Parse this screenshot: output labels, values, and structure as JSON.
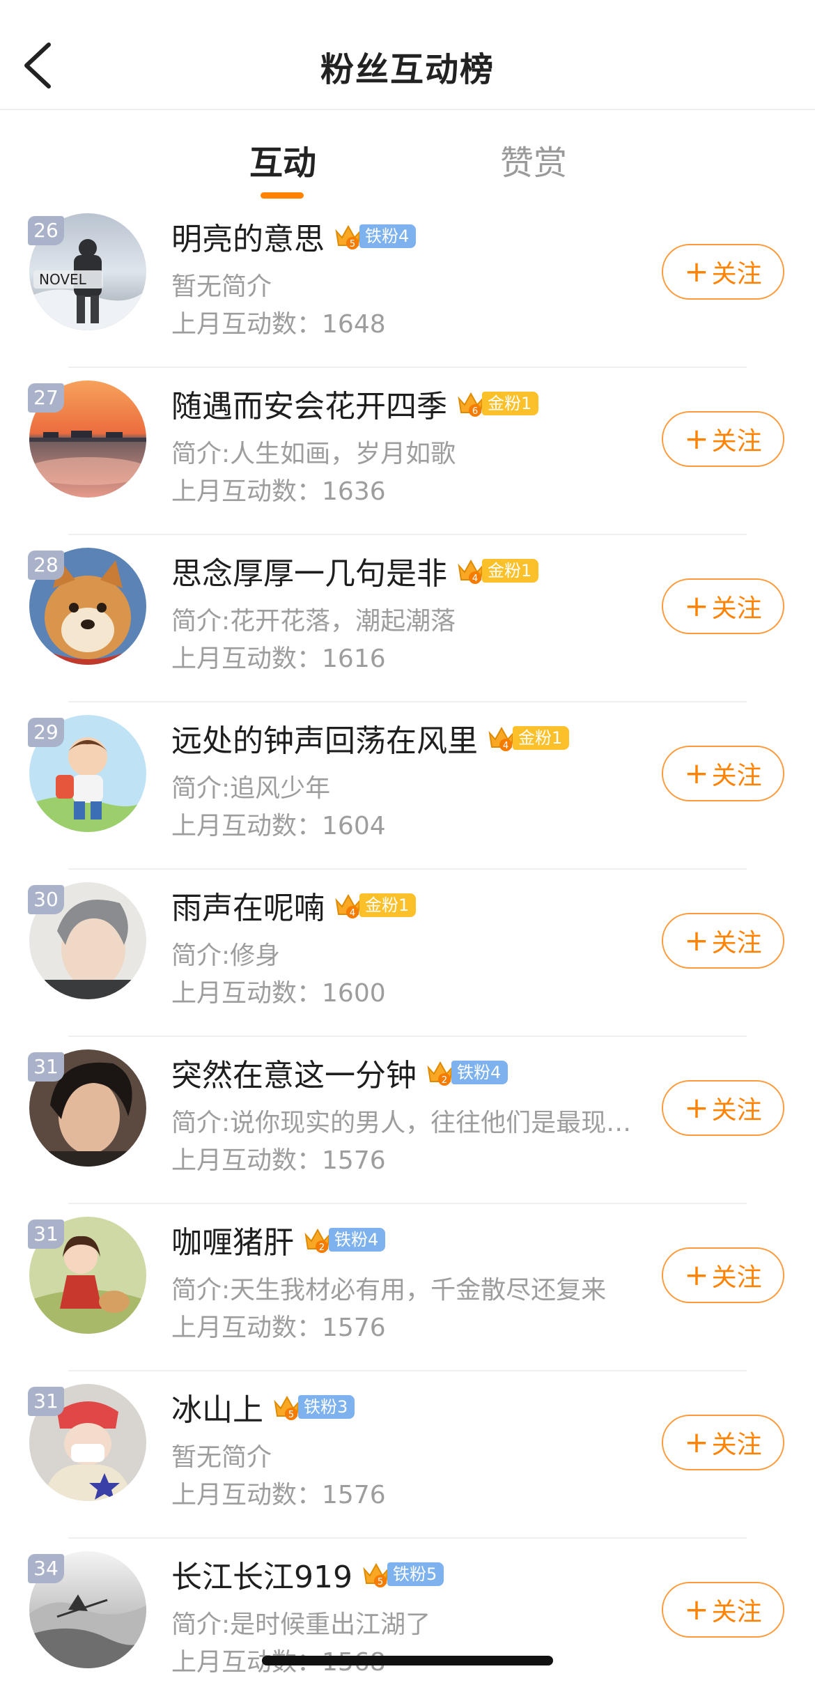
{
  "header": {
    "title": "粉丝互动榜",
    "back_icon": "chevron-left-icon"
  },
  "tabs": [
    {
      "label": "互动",
      "active": true
    },
    {
      "label": "赞赏",
      "active": false
    }
  ],
  "colors": {
    "accent": "#ff8200",
    "iron_badge": "#7eb2ef",
    "gold_badge": "#fcc12a",
    "rank_tag": "#a9b2c9",
    "secondary_text": "#9d9d9d"
  },
  "count_prefix": "上月互动数：",
  "follow_label": "关注",
  "fans": [
    {
      "rank": "26",
      "name": "明亮的意思",
      "crown_level": "5",
      "badge": "铁粉4",
      "badge_type": "iron",
      "bio": "暂无简介",
      "count": "1648"
    },
    {
      "rank": "27",
      "name": "随遇而安会花开四季",
      "crown_level": "6",
      "badge": "金粉1",
      "badge_type": "gold",
      "bio": "简介:人生如画，岁月如歌",
      "count": "1636"
    },
    {
      "rank": "28",
      "name": "思念厚厚一几句是非",
      "crown_level": "4",
      "badge": "金粉1",
      "badge_type": "gold",
      "bio": "简介:花开花落，潮起潮落",
      "count": "1616"
    },
    {
      "rank": "29",
      "name": "远处的钟声回荡在风里",
      "crown_level": "4",
      "badge": "金粉1",
      "badge_type": "gold",
      "bio": "简介:追风少年",
      "count": "1604"
    },
    {
      "rank": "30",
      "name": "雨声在呢喃",
      "crown_level": "4",
      "badge": "金粉1",
      "badge_type": "gold",
      "bio": "简介:修身",
      "count": "1600"
    },
    {
      "rank": "31",
      "name": "突然在意这一分钟",
      "crown_level": "2",
      "badge": "铁粉4",
      "badge_type": "iron",
      "bio": "简介:说你现实的男人，往往他们是最现…",
      "count": "1576"
    },
    {
      "rank": "31",
      "name": "咖喱猪肝",
      "crown_level": "2",
      "badge": "铁粉4",
      "badge_type": "iron",
      "bio": "简介:天生我材必有用，千金散尽还复来",
      "count": "1576"
    },
    {
      "rank": "31",
      "name": "冰山上",
      "crown_level": "5",
      "badge": "铁粉3",
      "badge_type": "iron",
      "bio": "暂无简介",
      "count": "1576"
    },
    {
      "rank": "34",
      "name": "长江长江919",
      "crown_level": "5",
      "badge": "铁粉5",
      "badge_type": "iron",
      "bio": "简介:是时候重出江湖了",
      "count": "1568"
    }
  ]
}
